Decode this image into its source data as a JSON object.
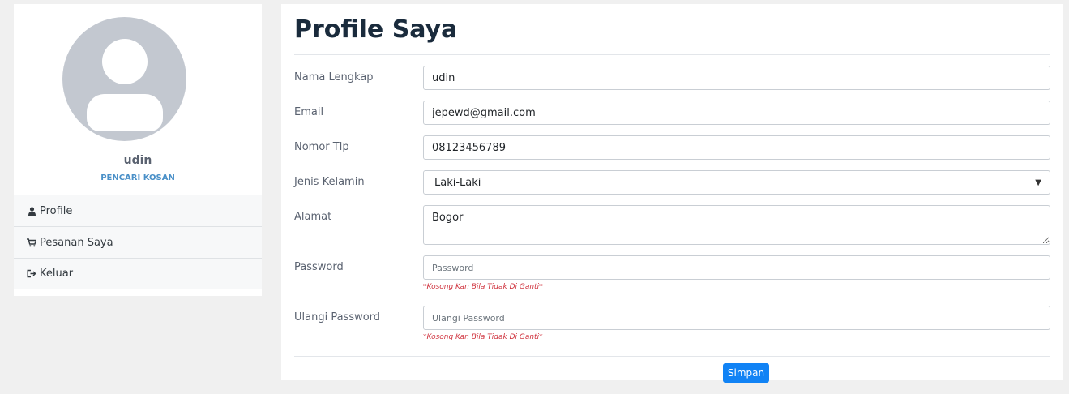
{
  "sidebar": {
    "user_name": "udin",
    "user_role": "PENCARI KOSAN",
    "menu": [
      {
        "label": "Profile",
        "icon": "user-icon"
      },
      {
        "label": "Pesanan Saya",
        "icon": "cart-icon"
      },
      {
        "label": "Keluar",
        "icon": "sign-out-icon"
      }
    ]
  },
  "main": {
    "title": "Profile Saya",
    "fields": {
      "nama": {
        "label": "Nama Lengkap",
        "value": "udin"
      },
      "email": {
        "label": "Email",
        "value": "jepewd@gmail.com"
      },
      "telp": {
        "label": "Nomor Tlp",
        "value": "08123456789"
      },
      "gender": {
        "label": "Jenis Kelamin",
        "value": "Laki-Laki"
      },
      "alamat": {
        "label": "Alamat",
        "value": "Bogor"
      },
      "password": {
        "label": "Password",
        "placeholder": "Password",
        "hint": "*Kosong Kan Bila Tidak Di Ganti*"
      },
      "password2": {
        "label": "Ulangi Password",
        "placeholder": "Ulangi Password",
        "hint": "*Kosong Kan Bila Tidak Di Ganti*"
      }
    },
    "save_label": "Simpan"
  },
  "colors": {
    "accent": "#1183f5",
    "hint": "#d0343f",
    "role": "#4a90c8"
  }
}
